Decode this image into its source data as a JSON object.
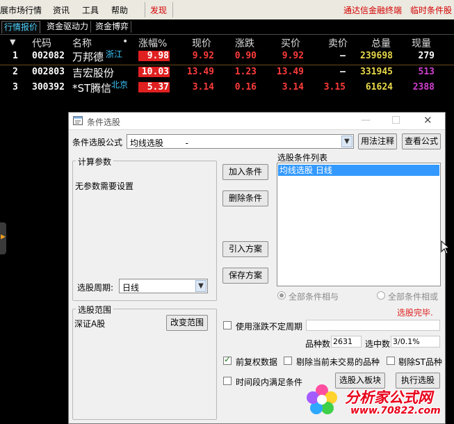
{
  "menu": {
    "items": [
      "展市场行情",
      "资讯",
      "工具",
      "帮助"
    ],
    "highlight": "发现",
    "right_links": [
      "通达信金融终端",
      "临时条件股"
    ]
  },
  "tabs": [
    "行情报价",
    "资金驱动力",
    "资金博弈"
  ],
  "table": {
    "headers": [
      "代码",
      "名称",
      "•",
      "涨幅%",
      "现价",
      "涨跌",
      "买价",
      "卖价",
      "总量",
      "现量"
    ],
    "rows": [
      {
        "idx": "1",
        "code": "002082",
        "name": "万邦德",
        "region": "浙江",
        "pct": "9.98",
        "price": "9.92",
        "change": "0.90",
        "bid": "9.92",
        "ask": "—",
        "volume": "239698",
        "now": "279"
      },
      {
        "idx": "2",
        "code": "002803",
        "name": "吉宏股份",
        "region": "",
        "pct": "10.03",
        "price": "13.49",
        "change": "1.23",
        "bid": "13.49",
        "ask": "—",
        "volume": "331945",
        "now": "513"
      },
      {
        "idx": "3",
        "code": "300392",
        "name": "*ST腾信",
        "region": "北京",
        "pct": "5.37",
        "price": "3.14",
        "change": "0.16",
        "bid": "3.14",
        "ask": "3.15",
        "volume": "61624",
        "now": "2388"
      }
    ]
  },
  "dialog": {
    "title": "条件选股",
    "formula_label": "条件选股公式",
    "formula_value": "均线选股 　　 -",
    "usage_button": "用法注释",
    "view_button": "查看公式",
    "params_group": "计算参数",
    "params_note": "无参数需要设置",
    "period_label": "选股周期:",
    "period_value": "日线",
    "add_button": "加入条件",
    "delete_button": "删除条件",
    "import_button": "引入方案",
    "save_button": "保存方案",
    "conditions_label": "选股条件列表",
    "conditions": [
      "均线选股  日线"
    ],
    "radio_and": "全部条件相与",
    "radio_or": "全部条件相或",
    "status": "选股完毕.",
    "range_group": "选股范围",
    "range_value": "深证A股",
    "change_range_button": "改变范围",
    "use_period_label": "使用涨跌不定周期",
    "count_label": "品种数",
    "count_value": "2631",
    "selected_label": "选中数",
    "selected_value": "3/0.1%",
    "adjust_label": "前复权数据",
    "exclude_untraded_label": "剔除当前未交易的品种",
    "exclude_st_label": "剔除ST品种",
    "time_label": "时间段内满足条件",
    "to_block_button": "选股入板块",
    "execute_button": "执行选股"
  },
  "watermark": {
    "name": "分析家公式网",
    "url": "www.70822.com"
  },
  "colors": {
    "up": "#ff3b3b",
    "volume": "#e8d84a",
    "now": "#d040d0",
    "region": "#3cc8ff",
    "selection": "#3399ff"
  }
}
